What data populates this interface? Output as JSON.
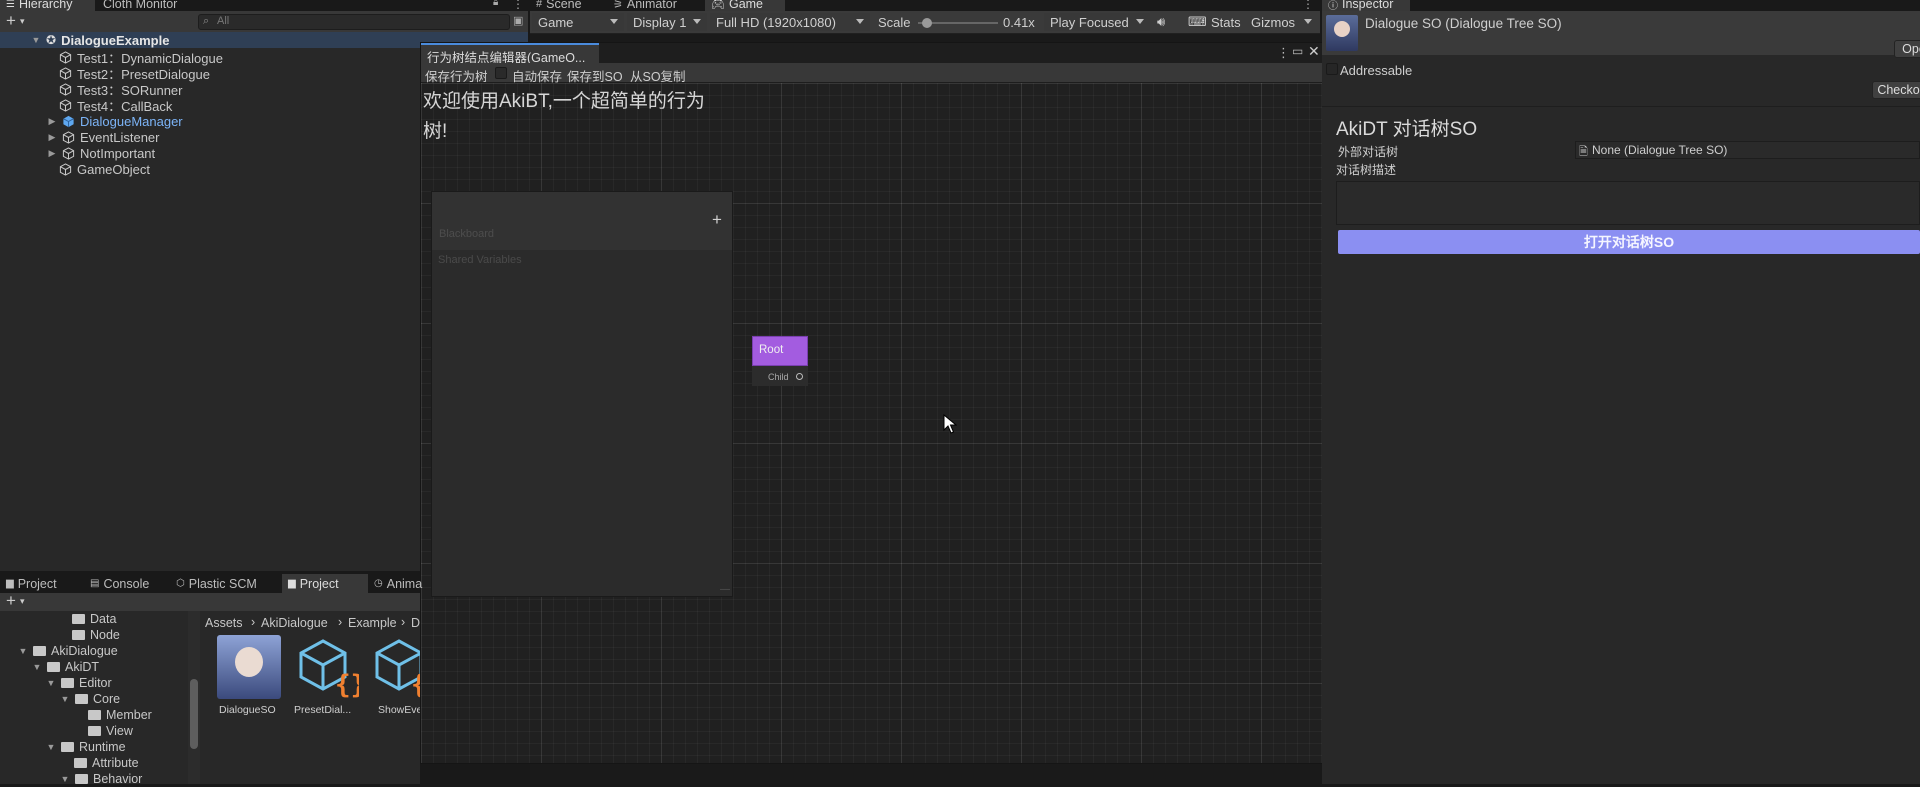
{
  "top_tabs": {
    "hierarchy": "Hierarchy",
    "cloth_monitor": "Cloth Monitor",
    "scene": "Scene",
    "animator": "Animator",
    "game": "Game",
    "inspector": "Inspector"
  },
  "hierarchy": {
    "search_placeholder": "All",
    "root": "DialogueExample",
    "items": [
      {
        "label": "Test1：DynamicDialogue"
      },
      {
        "label": "Test2：PresetDialogue"
      },
      {
        "label": "Test3：SORunner"
      },
      {
        "label": "Test4：CallBack"
      },
      {
        "label": "DialogueManager"
      },
      {
        "label": "EventListener"
      },
      {
        "label": "NotImportant"
      },
      {
        "label": "GameObject"
      }
    ]
  },
  "game_toolbar": {
    "mode": "Game",
    "display": "Display 1",
    "resolution": "Full HD (1920x1080)",
    "scale_label": "Scale",
    "scale_value": "0.41x",
    "scale_fraction": 0.05,
    "play_mode": "Play Focused",
    "stats": "Stats",
    "gizmos": "Gizmos"
  },
  "bt_editor": {
    "title": "行为树结点编辑器(GameO...",
    "toolbar": {
      "save_tree": "保存行为树",
      "auto_save": "自动保存",
      "save_to_so": "保存到SO",
      "copy_from_so": "从SO复制"
    },
    "welcome": "欢迎使用AkiBT,一个超简单的行为树!",
    "blackboard": {
      "title": "Blackboard",
      "add": "+",
      "shared_variables": "Shared Variables"
    },
    "root_node": {
      "title": "Root",
      "port": "Child"
    },
    "accent": "#a35ce0"
  },
  "inspector": {
    "object_name": "Dialogue SO (Dialogue Tree SO)",
    "open_button": "Ope",
    "addressable": "Addressable",
    "checkout_button": "Checkou",
    "section_title": "AkiDT 对话树SO",
    "external_tree_label": "外部对话树",
    "external_tree_value": "None (Dialogue Tree SO)",
    "description_label": "对话树描述",
    "open_tree_button": "打开对话树SO",
    "accent": "#8b8ff2"
  },
  "bottom_tabs": {
    "project1": "Project",
    "console": "Console",
    "plastic": "Plastic SCM",
    "project2": "Project",
    "animation": "Anima"
  },
  "project": {
    "tree": [
      {
        "label": "Data"
      },
      {
        "label": "Node"
      },
      {
        "label": "AkiDialogue"
      },
      {
        "label": "AkiDT"
      },
      {
        "label": "Editor"
      },
      {
        "label": "Core"
      },
      {
        "label": "Member"
      },
      {
        "label": "View"
      },
      {
        "label": "Runtime"
      },
      {
        "label": "Attribute"
      },
      {
        "label": "Behavior"
      }
    ],
    "breadcrumb": [
      "Assets",
      "AkiDialogue",
      "Example",
      "D"
    ],
    "assets": [
      {
        "label": "DialogueSO"
      },
      {
        "label": "PresetDial..."
      },
      {
        "label": "ShowEve"
      }
    ]
  }
}
